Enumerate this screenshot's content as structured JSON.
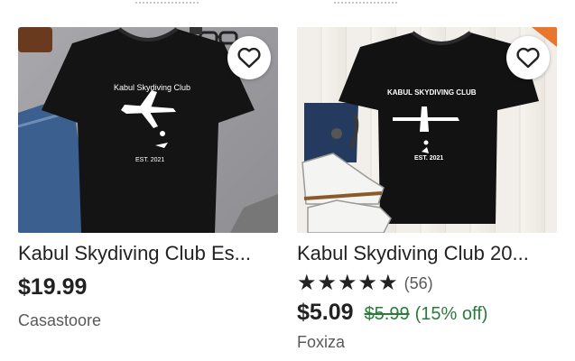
{
  "listings": [
    {
      "title": "Kabul Skydiving Club Es...",
      "shirt_text": "Kabul Skydiving Club",
      "shirt_est": "EST. 2021",
      "price": "$19.99",
      "shop": "Casastoore",
      "favorite_icon": "heart-icon"
    },
    {
      "title": "Kabul Skydiving Club 20...",
      "shirt_text": "KABUL SKYDIVING CLUB",
      "shirt_est": "EST. 2021",
      "stars": "★★★★★",
      "rating_count": "(56)",
      "price": "$5.09",
      "original_price": "$5.99",
      "discount": "(15% off)",
      "shop": "Foxiza",
      "favorite_icon": "heart-icon"
    }
  ],
  "colors": {
    "sale_green": "#2b7c3a",
    "text": "#222222",
    "muted": "#595959"
  }
}
